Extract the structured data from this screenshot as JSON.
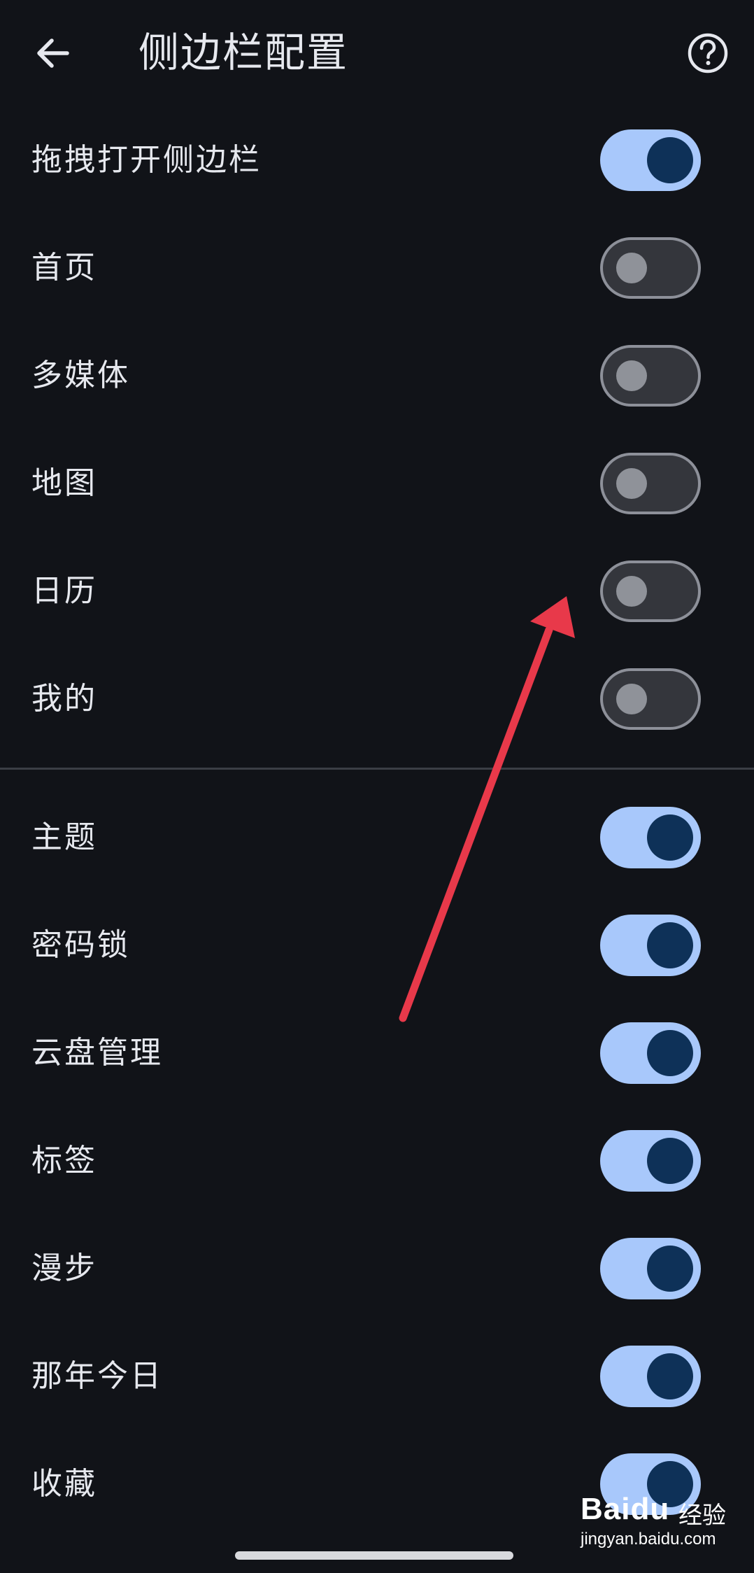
{
  "appbar": {
    "title": "侧边栏配置",
    "back_icon": "arrow-left-icon",
    "help_icon": "help-circle-icon"
  },
  "settings": [
    {
      "label": "拖拽打开侧边栏",
      "enabled": true
    },
    {
      "label": "首页",
      "enabled": false
    },
    {
      "label": "多媒体",
      "enabled": false
    },
    {
      "label": "地图",
      "enabled": false
    },
    {
      "label": "日历",
      "enabled": false
    },
    {
      "label": "我的",
      "enabled": false
    },
    {
      "label": "主题",
      "enabled": true
    },
    {
      "label": "密码锁",
      "enabled": true
    },
    {
      "label": "云盘管理",
      "enabled": true
    },
    {
      "label": "标签",
      "enabled": true
    },
    {
      "label": "漫步",
      "enabled": true
    },
    {
      "label": "那年今日",
      "enabled": true
    },
    {
      "label": "收藏",
      "enabled": true
    }
  ],
  "watermark": {
    "logo": "Baidu",
    "name": "经验",
    "url": "jingyan.baidu.com"
  },
  "colors": {
    "background": "#111318",
    "switch_on_track": "#a8c8fb",
    "switch_on_thumb": "#0e3158",
    "switch_off_track": "#34363c",
    "switch_off_border": "#8d9099",
    "annotation_arrow": "#e8394a"
  }
}
